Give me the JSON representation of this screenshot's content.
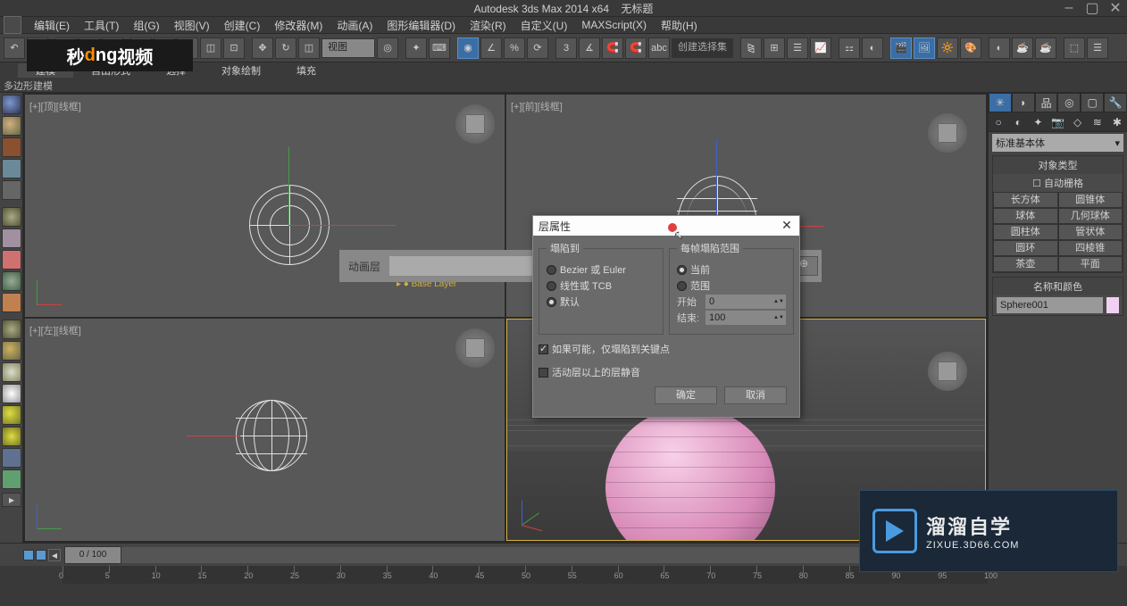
{
  "app": {
    "title": "Autodesk 3ds Max  2014 x64",
    "doc": "无标题"
  },
  "menu": [
    "编辑(E)",
    "工具(T)",
    "组(G)",
    "视图(V)",
    "创建(C)",
    "修改器(M)",
    "动画(A)",
    "图形编辑器(D)",
    "渲染(R)",
    "自定义(U)",
    "MAXScript(X)",
    "帮助(H)"
  ],
  "toolbar": {
    "view_dd": "视图",
    "named_sel": "创建选择集"
  },
  "logo": {
    "a": "秒",
    "b": "d",
    "c": "ng",
    "d": "视频"
  },
  "ribbon": {
    "tabs": [
      "建模",
      "自由形式",
      "选择",
      "对象绘制",
      "填充"
    ],
    "sub": "多边形建模"
  },
  "viewports": [
    {
      "label": "[+][顶][线框]"
    },
    {
      "label": "[+][前][线框]"
    },
    {
      "label": "[+][左][线框]"
    },
    {
      "label": ""
    }
  ],
  "anim_bar": {
    "label": "动画层",
    "base": "Base Layer"
  },
  "dialog": {
    "title": "层属性",
    "group1_title": "塌陷到",
    "opts1": [
      "Bezier 或 Euler",
      "线性或 TCB",
      "默认"
    ],
    "group2_title": "每帧塌陷范围",
    "range_opts": [
      "当前",
      "范围"
    ],
    "start_label": "开始",
    "start_val": "0",
    "end_label": "结束:",
    "end_val": "100",
    "chk1": "如果可能，仅塌陷到关键点",
    "chk2": "活动层以上的层静音",
    "ok": "确定",
    "cancel": "取消"
  },
  "right": {
    "dd": "标准基本体",
    "sect1": "对象类型",
    "autogrid": "自动栅格",
    "prims": [
      [
        "长方体",
        "圆锥体"
      ],
      [
        "球体",
        "几何球体"
      ],
      [
        "圆柱体",
        "管状体"
      ],
      [
        "圆环",
        "四棱锥"
      ],
      [
        "茶壶",
        "平面"
      ]
    ],
    "sect2": "名称和颜色",
    "obj_name": "Sphere001"
  },
  "timeline": {
    "pos": "0 / 100",
    "ticks": [
      0,
      5,
      10,
      15,
      20,
      25,
      30,
      35,
      40,
      45,
      50,
      55,
      60,
      65,
      70,
      75,
      80,
      85,
      90,
      95,
      100
    ]
  },
  "bottom_overlay": {
    "big": "溜溜自学",
    "small": "ZIXUE.3D66.COM"
  }
}
